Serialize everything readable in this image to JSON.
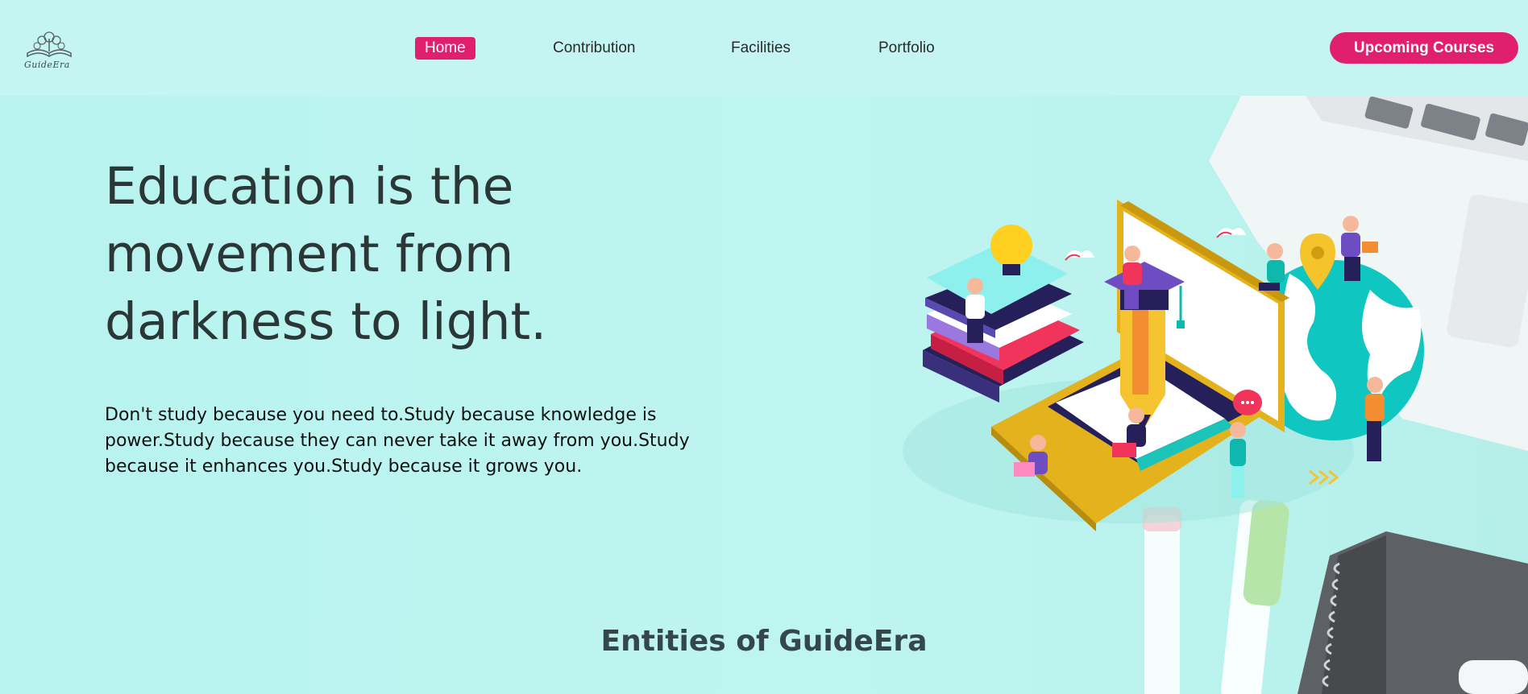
{
  "brand": {
    "logo_text": "GuideEra"
  },
  "nav": {
    "items": [
      {
        "label": "Home",
        "active": true
      },
      {
        "label": "Contribution",
        "active": false
      },
      {
        "label": "Facilities",
        "active": false
      },
      {
        "label": "Portfolio",
        "active": false
      }
    ],
    "cta_label": "Upcoming Courses"
  },
  "hero": {
    "headline": "Education is the movement from darkness to light.",
    "subtext": "Don't study because you need to.Study because knowledge is power.Study because they can never take it away from you.Study because it enhances you.Study because it grows you."
  },
  "sections": {
    "entities_title": "Entities of GuideEra"
  },
  "colors": {
    "accent": "#e0206f",
    "header_bg": "#c4f5f2",
    "hero_bg": "#bff5f1",
    "text_dark": "#2b3636"
  },
  "icons": {
    "logo": "open-book-tree-logo-icon",
    "illustration": "isometric-education-laptop-illustration"
  }
}
